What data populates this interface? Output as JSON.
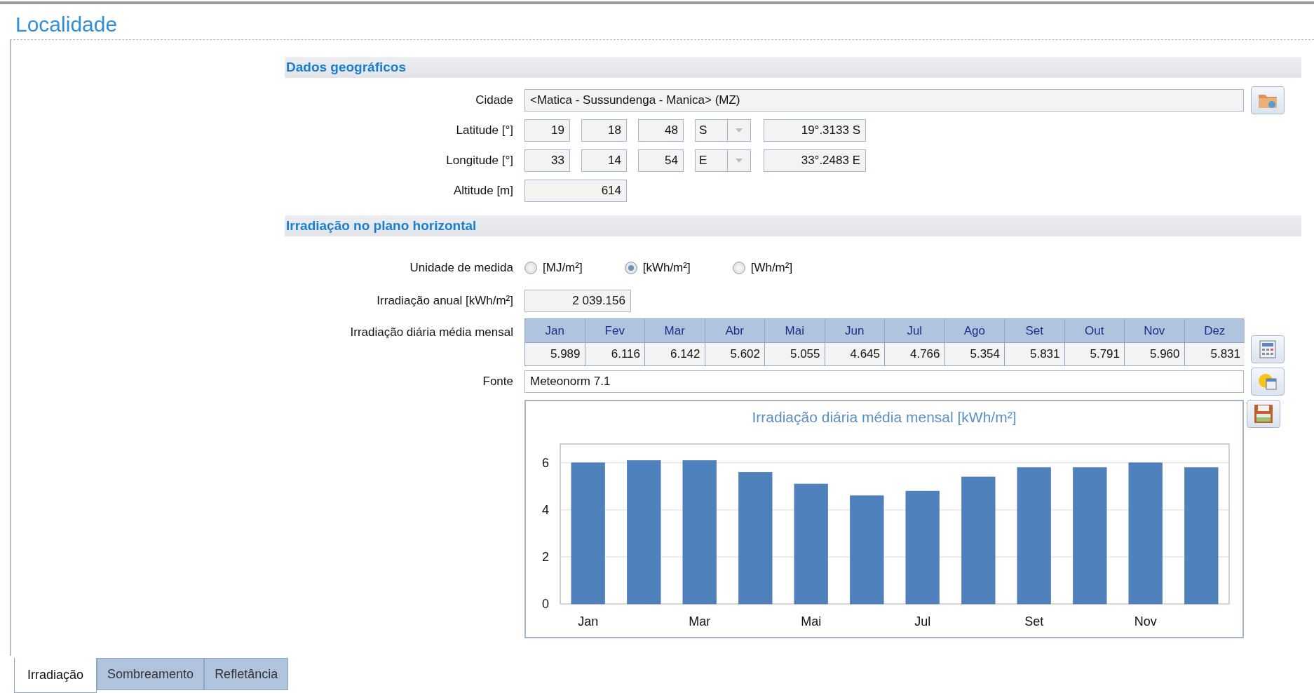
{
  "title": "Localidade",
  "geo": {
    "heading": "Dados geográficos",
    "city_label": "Cidade",
    "city": "<Matica - Sussundenga - Manica> (MZ)",
    "coords": [
      {
        "label": "Latitude [°]",
        "deg": "19",
        "min": "18",
        "sec": "48",
        "hemisphere": "S",
        "decimal": "19°.3133 S"
      },
      {
        "label": "Longitude [°]",
        "deg": "33",
        "min": "14",
        "sec": "54",
        "hemisphere": "E",
        "decimal": "33°.2483 E"
      }
    ],
    "altitude_label": "Altitude [m]",
    "altitude": "614"
  },
  "irradiation": {
    "heading": "Irradiação no plano horizontal",
    "unit_label": "Unidade de medida",
    "units": [
      {
        "label": "[MJ/m²]",
        "selected": false
      },
      {
        "label": "[kWh/m²]",
        "selected": true
      },
      {
        "label": "[Wh/m²]",
        "selected": false
      }
    ],
    "annual_label": "Irradiação anual [kWh/m²]",
    "annual": "2 039.156",
    "monthly_label": "Irradiação diária média mensal",
    "months": [
      "Jan",
      "Fev",
      "Mar",
      "Abr",
      "Mai",
      "Jun",
      "Jul",
      "Ago",
      "Set",
      "Out",
      "Nov",
      "Dez"
    ],
    "values": [
      "5.989",
      "6.116",
      "6.142",
      "5.602",
      "5.055",
      "4.645",
      "4.766",
      "5.354",
      "5.831",
      "5.791",
      "5.960",
      "5.831"
    ],
    "source_label": "Fonte",
    "source": "Meteonorm 7.1",
    "chart_data": {
      "type": "bar",
      "title": "Irradiação diária média mensal [kWh/m²]",
      "categories": [
        "Jan",
        null,
        "Mar",
        null,
        "Mai",
        null,
        "Jul",
        null,
        "Set",
        null,
        "Nov",
        null
      ],
      "series": [
        {
          "color": "#4f81bd",
          "values": [
            6.0,
            6.1,
            6.1,
            5.6,
            5.1,
            4.6,
            4.8,
            5.4,
            5.8,
            5.8,
            6.0,
            5.8
          ]
        }
      ],
      "ylim": [
        0,
        6.8
      ],
      "yticks": [
        0,
        2,
        4,
        6
      ],
      "grid": true
    }
  },
  "tabs": [
    {
      "label": "Irradiação",
      "selected": true
    },
    {
      "label": "Sombreamento",
      "selected": false
    },
    {
      "label": "Refletância",
      "selected": false
    }
  ]
}
